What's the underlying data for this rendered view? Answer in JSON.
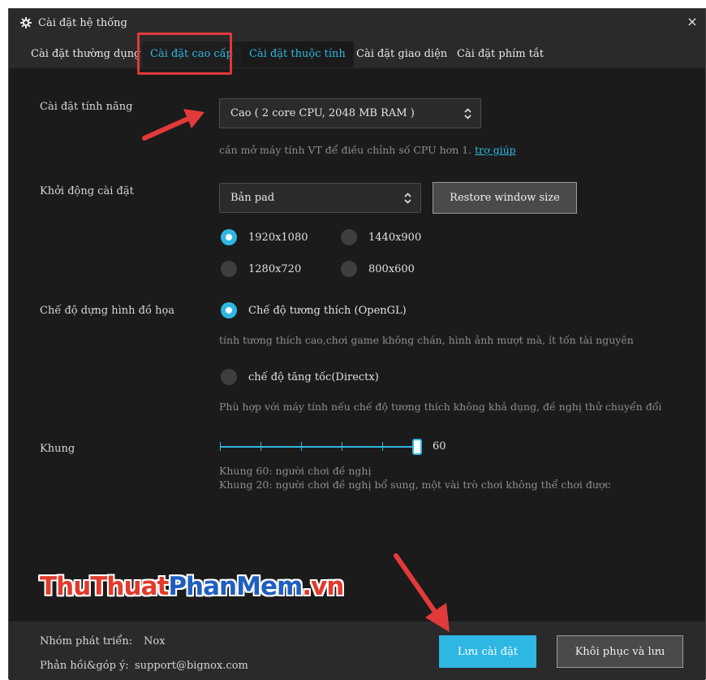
{
  "window": {
    "title": "Cài đặt hệ thống",
    "close_glyph": "×"
  },
  "tabs": [
    {
      "label": "Cài đặt thường dụng"
    },
    {
      "label": "Cài đặt cao cấp"
    },
    {
      "label": "Cài đặt thuộc tính"
    },
    {
      "label": "Cài đặt giao diện"
    },
    {
      "label": "Cài đặt phím tắt"
    }
  ],
  "performance": {
    "label": "Cài đặt tính năng",
    "value": "Cao ( 2 core CPU, 2048 MB RAM )",
    "hint": "cần mở máy tính VT để điều chỉnh số CPU hơn 1.",
    "hint_link": "trợ giúp"
  },
  "startup": {
    "label": "Khởi động cài đặt",
    "value": "Bản pad",
    "restore_button": "Restore window size",
    "resolutions": [
      {
        "label": "1920x1080",
        "selected": true
      },
      {
        "label": "1440x900",
        "selected": false
      },
      {
        "label": "1280x720",
        "selected": false
      },
      {
        "label": "800x600",
        "selected": false
      }
    ]
  },
  "graphics": {
    "label": "Chế độ dựng hình đồ họa",
    "option1": "Chế độ tương thích (OpenGL)",
    "option1_hint": "tính tương thích cao,chơi game không chán, hình ảnh mượt mà, ít tốn tài nguyên",
    "option2": "chế độ tăng tốc(Directx)",
    "option2_hint": "Phù hợp với máy tính nếu chế độ tương thích không khả dụng, đề nghị thử chuyển đổi"
  },
  "frame": {
    "label": "Khung",
    "value": "60",
    "hint1": "Khung 60: người chơi đề nghị",
    "hint2": "Khung 20: người chơi đề nghị bổ sung, một vài trò chơi không thể chơi được"
  },
  "watermark": {
    "part1": "ThuThuat",
    "part2": "PhanMem",
    "part3": ".vn"
  },
  "footer": {
    "dev_label": "Nhóm phát triển:",
    "dev_value": "Nox",
    "feedback_label": "Phản hồi&góp ý:",
    "feedback_value": "support@bignox.com",
    "save_button": "Lưu cài đặt",
    "restore_save_button": "Khôi phục và lưu"
  },
  "colors": {
    "accent": "#2fb7e4",
    "highlight": "#e03a3a",
    "background": "#1b1b1b"
  }
}
